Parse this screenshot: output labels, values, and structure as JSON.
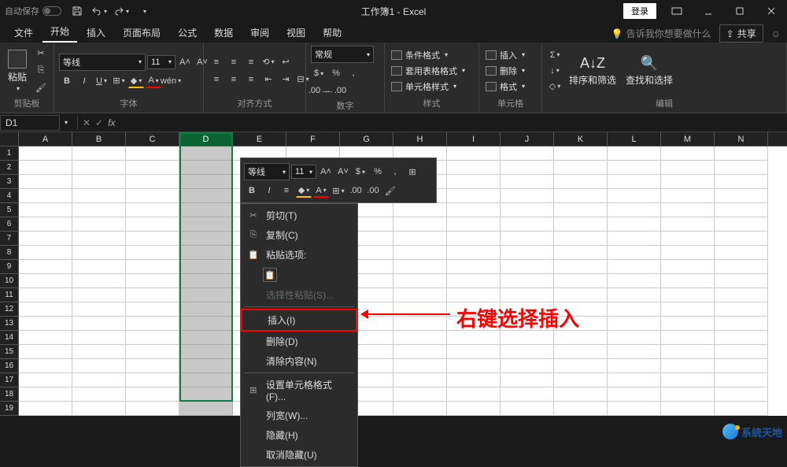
{
  "titlebar": {
    "auto_save": "自动保存",
    "title": "工作簿1 - Excel",
    "login": "登录"
  },
  "tabs": {
    "items": [
      "文件",
      "开始",
      "插入",
      "页面布局",
      "公式",
      "数据",
      "审阅",
      "视图",
      "帮助"
    ],
    "active_index": 1,
    "tell_me": "告诉我你想要做什么",
    "share": "共享"
  },
  "ribbon": {
    "clipboard": {
      "paste": "粘贴",
      "label": "剪贴板"
    },
    "font": {
      "name": "等线",
      "size": "11",
      "label": "字体"
    },
    "align": {
      "label": "对齐方式"
    },
    "number": {
      "format": "常规",
      "label": "数字"
    },
    "styles": {
      "cond": "条件格式",
      "table": "套用表格格式",
      "cell": "单元格样式",
      "label": "样式"
    },
    "cells": {
      "insert": "插入",
      "delete": "删除",
      "format": "格式",
      "label": "单元格"
    },
    "editing": {
      "sort": "排序和筛选",
      "find": "查找和选择",
      "label": "编辑"
    }
  },
  "namebox": {
    "value": "D1"
  },
  "grid": {
    "columns": [
      "A",
      "B",
      "C",
      "D",
      "E",
      "F",
      "G",
      "H",
      "I",
      "J",
      "K",
      "L",
      "M",
      "N"
    ],
    "rows": 19,
    "selected_col_index": 3
  },
  "mini_toolbar": {
    "font": "等线",
    "size": "11"
  },
  "context_menu": {
    "cut": "剪切(T)",
    "copy": "复制(C)",
    "paste_options": "粘贴选项:",
    "paste_special": "选择性粘贴(S)...",
    "insert": "插入(I)",
    "delete": "删除(D)",
    "clear": "清除内容(N)",
    "format_cells": "设置单元格格式(F)...",
    "col_width": "列宽(W)...",
    "hide": "隐藏(H)",
    "unhide": "取消隐藏(U)"
  },
  "annotation": "右键选择插入",
  "watermark": "系统天地"
}
